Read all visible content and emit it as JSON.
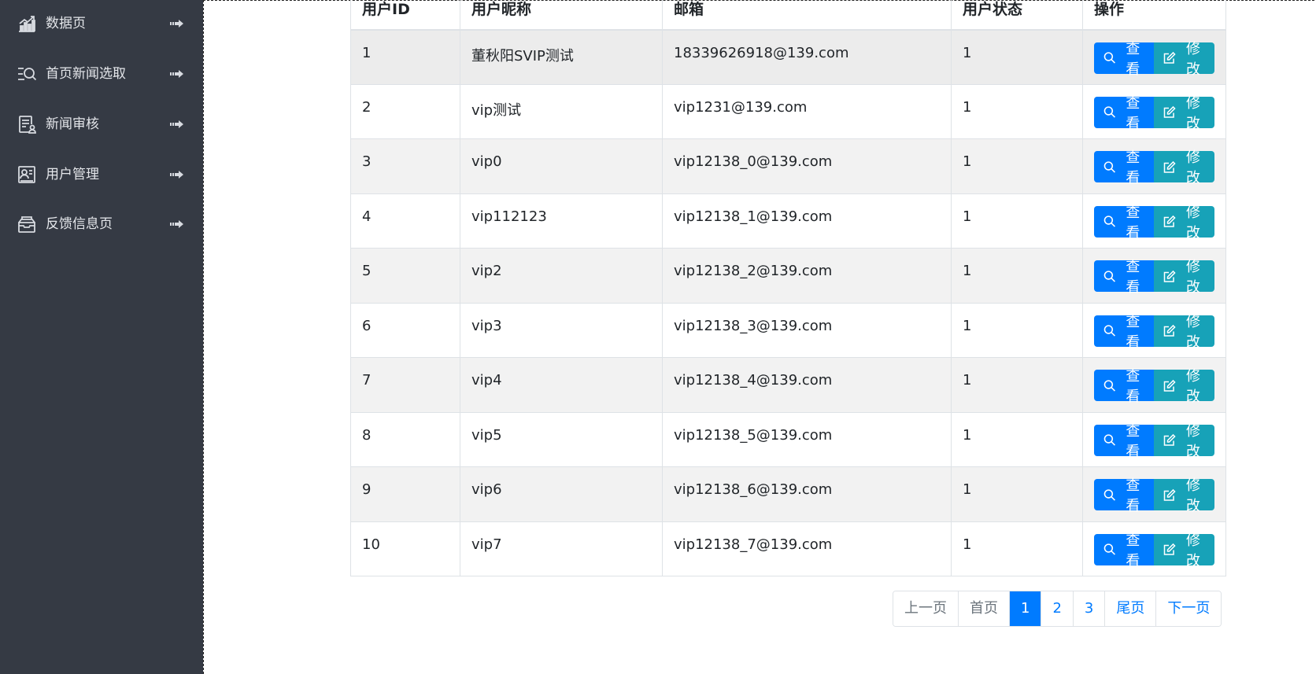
{
  "sidebar": {
    "items": [
      {
        "label": "数据页",
        "icon": "bar-chart-icon"
      },
      {
        "label": "首页新闻选取",
        "icon": "list-search-icon"
      },
      {
        "label": "新闻审核",
        "icon": "document-user-icon"
      },
      {
        "label": "用户管理",
        "icon": "user-card-icon"
      },
      {
        "label": "反馈信息页",
        "icon": "inbox-icon"
      }
    ]
  },
  "table": {
    "headers": [
      "用户ID",
      "用户昵称",
      "邮箱",
      "用户状态",
      "操作"
    ],
    "rows": [
      {
        "id": "1",
        "nickname": "董秋阳SVIP测试",
        "email": "18339626918@139.com",
        "status": "1"
      },
      {
        "id": "2",
        "nickname": "vip测试",
        "email": "vip1231@139.com",
        "status": "1"
      },
      {
        "id": "3",
        "nickname": "vip0",
        "email": "vip12138_0@139.com",
        "status": "1"
      },
      {
        "id": "4",
        "nickname": "vip112123",
        "email": "vip12138_1@139.com",
        "status": "1"
      },
      {
        "id": "5",
        "nickname": "vip2",
        "email": "vip12138_2@139.com",
        "status": "1"
      },
      {
        "id": "6",
        "nickname": "vip3",
        "email": "vip12138_3@139.com",
        "status": "1"
      },
      {
        "id": "7",
        "nickname": "vip4",
        "email": "vip12138_4@139.com",
        "status": "1"
      },
      {
        "id": "8",
        "nickname": "vip5",
        "email": "vip12138_5@139.com",
        "status": "1"
      },
      {
        "id": "9",
        "nickname": "vip6",
        "email": "vip12138_6@139.com",
        "status": "1"
      },
      {
        "id": "10",
        "nickname": "vip7",
        "email": "vip12138_7@139.com",
        "status": "1"
      }
    ],
    "view_label": "查看",
    "edit_label": "修改"
  },
  "pagination": {
    "prev": "上一页",
    "first": "首页",
    "pages": [
      "1",
      "2",
      "3"
    ],
    "active_page": "1",
    "last": "尾页",
    "next": "下一页"
  },
  "colors": {
    "sidebar_bg": "#353a44",
    "primary": "#007bff",
    "info": "#17a2b8"
  }
}
